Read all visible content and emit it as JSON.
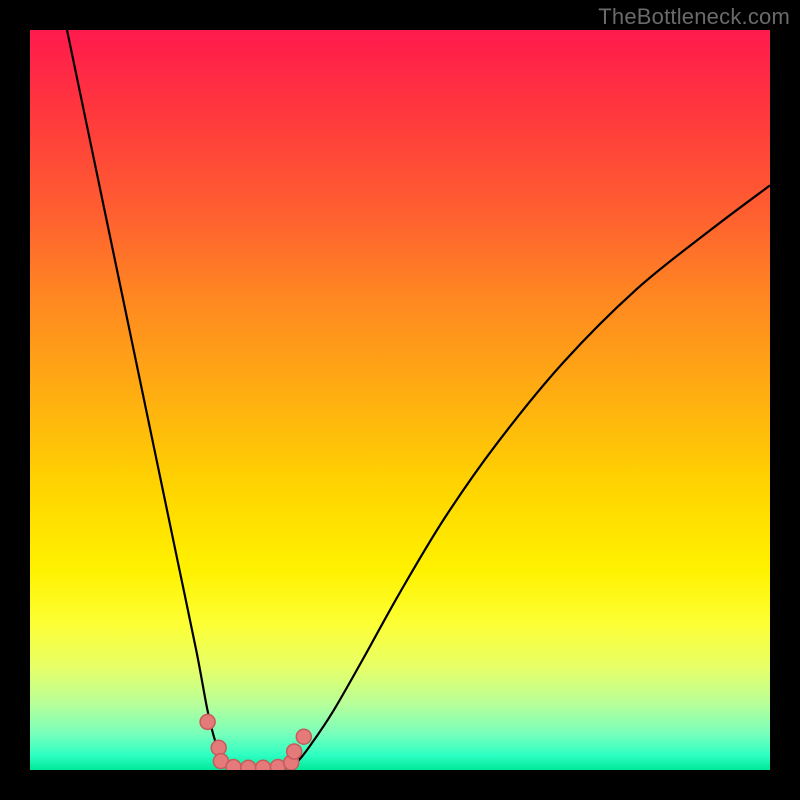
{
  "watermark": "TheBottleneck.com",
  "chart_data": {
    "type": "line",
    "title": "",
    "xlabel": "",
    "ylabel": "",
    "xlim": [
      0,
      100
    ],
    "ylim": [
      0,
      100
    ],
    "series": [
      {
        "name": "left-curve",
        "x": [
          5,
          7.5,
          10,
          12.5,
          15,
          17.5,
          20,
          22.5,
          24,
          25,
          26,
          27,
          28
        ],
        "y": [
          100,
          88,
          76,
          64,
          52,
          40,
          28,
          16,
          8,
          4,
          1.5,
          0.5,
          0
        ]
      },
      {
        "name": "right-curve",
        "x": [
          34,
          36,
          38,
          41,
          45,
          50,
          56,
          63,
          72,
          82,
          92,
          100
        ],
        "y": [
          0,
          1,
          3.5,
          8,
          15,
          24,
          34,
          44,
          55,
          65,
          73,
          79
        ]
      },
      {
        "name": "valley-floor",
        "x": [
          28,
          34
        ],
        "y": [
          0,
          0
        ]
      }
    ],
    "scatter_points": {
      "name": "markers",
      "x": [
        24.0,
        25.5,
        25.8,
        27.5,
        29.5,
        31.5,
        33.5,
        35.3,
        35.7,
        37.0
      ],
      "y": [
        6.5,
        3.0,
        1.2,
        0.4,
        0.3,
        0.3,
        0.4,
        1.0,
        2.5,
        4.5
      ],
      "color": "#e47a7a"
    },
    "background_gradient": {
      "top": "#ff1a4d",
      "mid": "#fff200",
      "bottom": "#00e89a"
    }
  }
}
